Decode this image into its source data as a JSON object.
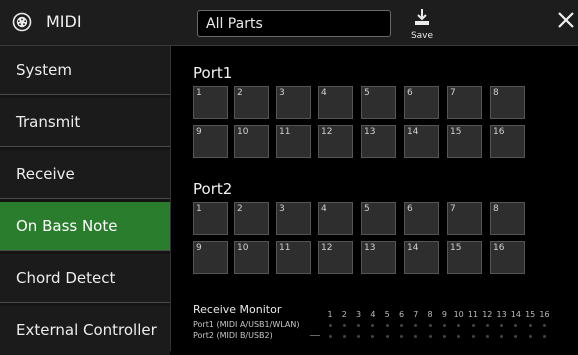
{
  "header": {
    "app_title": "MIDI",
    "app_icon": "midi-connector-icon",
    "parts_selector": "All Parts",
    "save_label": "Save",
    "close_icon": "close-icon"
  },
  "sidebar": {
    "items": [
      {
        "label": "System",
        "active": false
      },
      {
        "label": "Transmit",
        "active": false
      },
      {
        "label": "Receive",
        "active": false
      },
      {
        "label": "On Bass Note",
        "active": true
      },
      {
        "label": "Chord Detect",
        "active": false
      },
      {
        "label": "External Controller",
        "active": false
      }
    ],
    "accent_color": "#2b7d2e"
  },
  "ports": [
    {
      "title": "Port1",
      "channels": [
        "1",
        "2",
        "3",
        "4",
        "5",
        "6",
        "7",
        "8",
        "9",
        "10",
        "11",
        "12",
        "13",
        "14",
        "15",
        "16"
      ]
    },
    {
      "title": "Port2",
      "channels": [
        "1",
        "2",
        "3",
        "4",
        "5",
        "6",
        "7",
        "8",
        "9",
        "10",
        "11",
        "12",
        "13",
        "14",
        "15",
        "16"
      ]
    }
  ],
  "receive_monitor": {
    "title": "Receive Monitor",
    "channel_numbers": [
      "1",
      "2",
      "3",
      "4",
      "5",
      "6",
      "7",
      "8",
      "9",
      "10",
      "11",
      "12",
      "13",
      "14",
      "15",
      "16"
    ],
    "rows": [
      {
        "label": "Port1 (MIDI A/USB1/WLAN)"
      },
      {
        "label": "Port2 (MIDI B/USB2)"
      }
    ]
  }
}
